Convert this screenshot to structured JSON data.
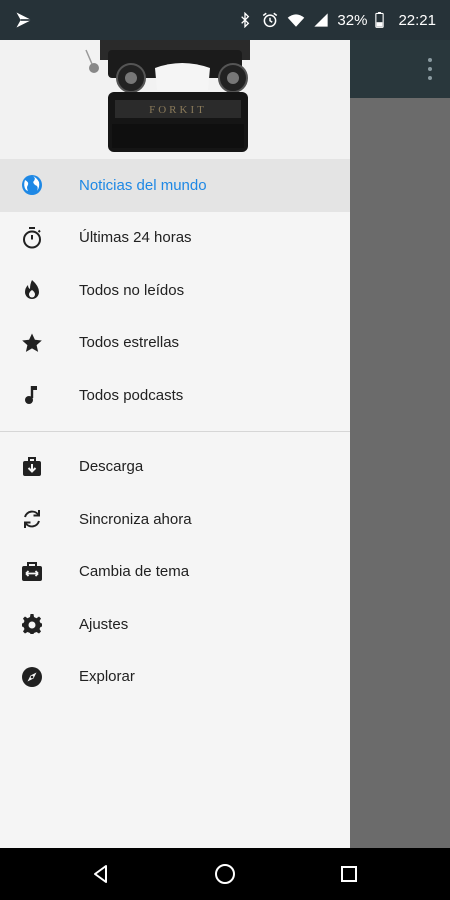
{
  "status_bar": {
    "battery_percent": "32%",
    "time": "22:21",
    "icons": [
      "app-logo-icon",
      "bluetooth-icon",
      "alarm-icon",
      "wifi-icon",
      "signal-icon",
      "battery-icon"
    ]
  },
  "toolbar": {
    "overflow_icon": "more-vert-icon"
  },
  "drawer": {
    "header_image": "typewriter-photo",
    "primary_items": [
      {
        "label": "Noticias del mundo",
        "icon": "globe-icon",
        "selected": true
      },
      {
        "label": "Últimas 24 horas",
        "icon": "timer-icon",
        "selected": false
      },
      {
        "label": "Todos no leídos",
        "icon": "flame-icon",
        "selected": false
      },
      {
        "label": "Todos estrellas",
        "icon": "star-icon",
        "selected": false
      },
      {
        "label": "Todos podcasts",
        "icon": "music-note-icon",
        "selected": false
      }
    ],
    "secondary_items": [
      {
        "label": "Descarga",
        "icon": "download-icon"
      },
      {
        "label": "Sincroniza ahora",
        "icon": "sync-icon"
      },
      {
        "label": "Cambia de tema",
        "icon": "theme-icon"
      },
      {
        "label": "Ajustes",
        "icon": "gear-icon"
      },
      {
        "label": "Explorar",
        "icon": "compass-icon"
      }
    ]
  },
  "colors": {
    "accent": "#1e88e5",
    "toolbar": "#29373c",
    "status_bar": "#263238",
    "drawer_bg": "#f5f5f5"
  },
  "nav_bar": {
    "icons": [
      "back-icon",
      "home-icon",
      "recents-icon"
    ]
  }
}
